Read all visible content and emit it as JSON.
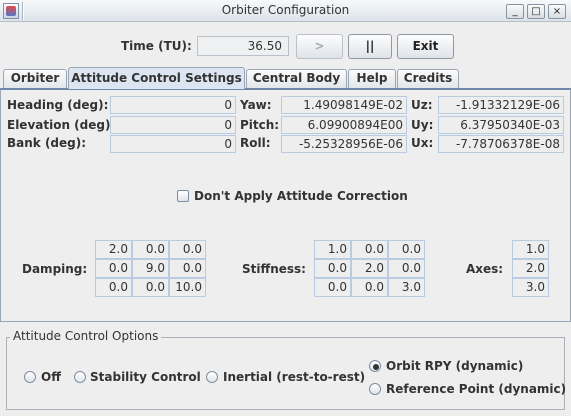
{
  "window": {
    "title": "Orbiter Configuration",
    "min_label": "_",
    "max_label": "□",
    "close_label": "×"
  },
  "time": {
    "label": "Time (TU):",
    "value": "36.50"
  },
  "buttons": {
    "play": ">",
    "pause": "||",
    "exit": "Exit"
  },
  "tabs": [
    {
      "label": "Orbiter"
    },
    {
      "label": "Attitude Control Settings",
      "active": true
    },
    {
      "label": "Central Body"
    },
    {
      "label": "Help"
    },
    {
      "label": "Credits"
    }
  ],
  "angles": [
    {
      "label": "Heading (deg):",
      "value": "0"
    },
    {
      "label": "Elevation (deg):",
      "value": "0"
    },
    {
      "label": "Bank (deg):",
      "value": "0"
    }
  ],
  "rates": [
    {
      "label": "Yaw:",
      "value": "1.49098149E-02"
    },
    {
      "label": "Pitch:",
      "value": "6.09900894E00"
    },
    {
      "label": "Roll:",
      "value": "-5.25328956E-06"
    }
  ],
  "unit_vector": [
    {
      "label": "Uz:",
      "value": "-1.91332129E-06"
    },
    {
      "label": "Uy:",
      "value": "6.37950340E-03"
    },
    {
      "label": "Ux:",
      "value": "-7.78706378E-08"
    }
  ],
  "correction_checkbox": {
    "label": "Don't Apply Attitude Correction",
    "checked": false
  },
  "damping": {
    "label": "Damping:",
    "rows": [
      [
        "2.0",
        "0.0",
        "0.0"
      ],
      [
        "0.0",
        "9.0",
        "0.0"
      ],
      [
        "0.0",
        "0.0",
        "10.0"
      ]
    ]
  },
  "stiffness": {
    "label": "Stiffness:",
    "rows": [
      [
        "1.0",
        "0.0",
        "0.0"
      ],
      [
        "0.0",
        "2.0",
        "0.0"
      ],
      [
        "0.0",
        "0.0",
        "3.0"
      ]
    ]
  },
  "axes": {
    "label": "Axes:",
    "values": [
      "1.0",
      "2.0",
      "3.0"
    ]
  },
  "options": {
    "title": "Attitude Control Options",
    "items": [
      {
        "label": "Off",
        "selected": false
      },
      {
        "label": "Stability Control",
        "selected": false
      },
      {
        "label": "Inertial (rest-to-rest)",
        "selected": false
      },
      {
        "label": "Orbit RPY (dynamic)",
        "selected": true
      },
      {
        "label": "Reference Point (dynamic)",
        "selected": false
      }
    ]
  }
}
